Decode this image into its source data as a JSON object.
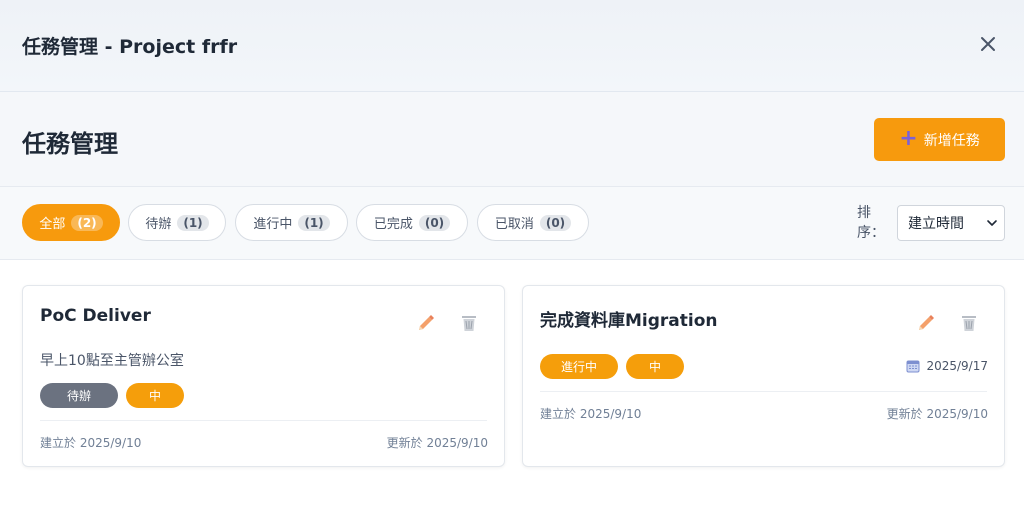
{
  "window": {
    "title": "任務管理 - Project frfr"
  },
  "header": {
    "title": "任務管理",
    "add_button_label": "新增任務"
  },
  "filters": [
    {
      "label": "全部",
      "count": "(2)",
      "active": true
    },
    {
      "label": "待辦",
      "count": "(1)",
      "active": false
    },
    {
      "label": "進行中",
      "count": "(1)",
      "active": false
    },
    {
      "label": "已完成",
      "count": "(0)",
      "active": false
    },
    {
      "label": "已取消",
      "count": "(0)",
      "active": false
    }
  ],
  "sort": {
    "label": "排序：",
    "selected": "建立時間"
  },
  "tasks": [
    {
      "title": "PoC Deliver",
      "description": "早上10點至主管辦公室",
      "status": "待辦",
      "priority": "中",
      "created": "建立於 2025/9/10",
      "updated": "更新於 2025/9/10"
    },
    {
      "title": "完成資料庫Migration",
      "status": "進行中",
      "priority": "中",
      "due": "2025/9/17",
      "created": "建立於 2025/9/10",
      "updated": "更新於 2025/9/10"
    }
  ],
  "colors": {
    "accent": "#f79a0d",
    "status_todo": "#6b7280",
    "priority_medium": "#f59e0b"
  }
}
